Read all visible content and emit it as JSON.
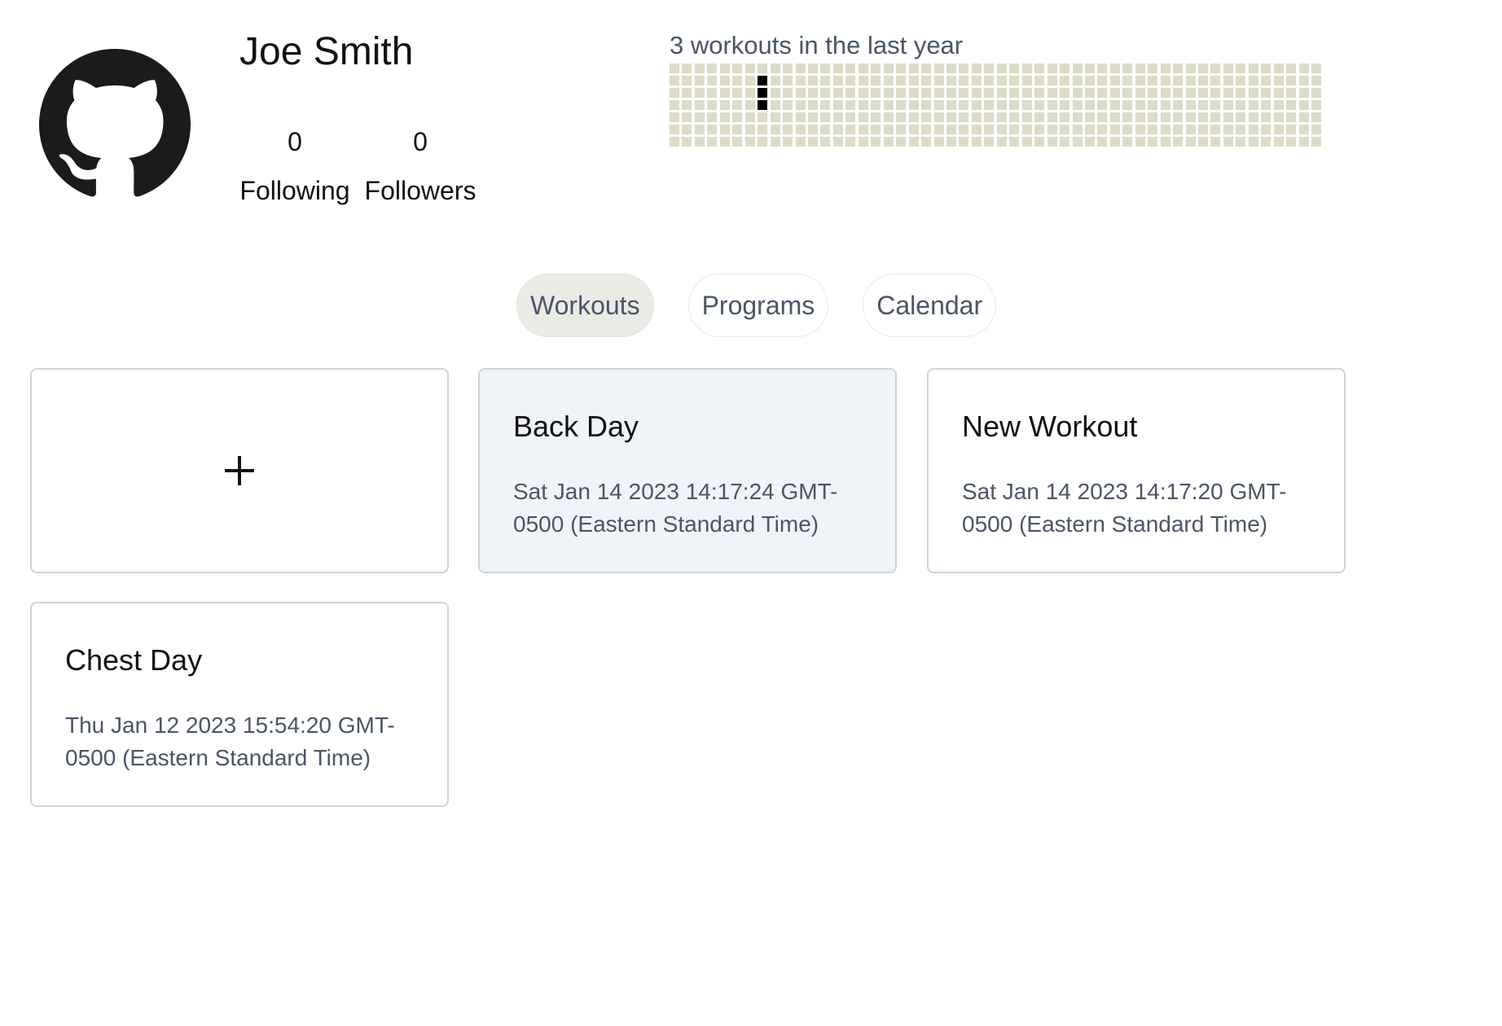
{
  "profile": {
    "name": "Joe Smith",
    "avatar_icon": "github-octocat-icon",
    "following_count": "0",
    "following_label": "Following",
    "followers_count": "0",
    "followers_label": "Followers"
  },
  "activity": {
    "title": "3 workouts in the last year",
    "weeks": 52,
    "days_per_week": 7,
    "active_cells": [
      {
        "week": 7,
        "day": 1
      },
      {
        "week": 7,
        "day": 2
      },
      {
        "week": 7,
        "day": 3
      }
    ],
    "empty_color": "#dcdcc8",
    "active_color": "#000000"
  },
  "tabs": [
    {
      "label": "Workouts",
      "active": true
    },
    {
      "label": "Programs",
      "active": false
    },
    {
      "label": "Calendar",
      "active": false
    }
  ],
  "add_card": {
    "icon": "plus-icon"
  },
  "workouts": [
    {
      "title": "Back Day",
      "date": "Sat Jan 14 2023 14:17:24 GMT-0500 (Eastern Standard Time)"
    },
    {
      "title": "New Workout",
      "date": "Sat Jan 14 2023 14:17:20 GMT-0500 (Eastern Standard Time)"
    },
    {
      "title": "Chest Day",
      "date": "Thu Jan 12 2023 15:54:20 GMT-0500 (Eastern Standard Time)"
    }
  ]
}
